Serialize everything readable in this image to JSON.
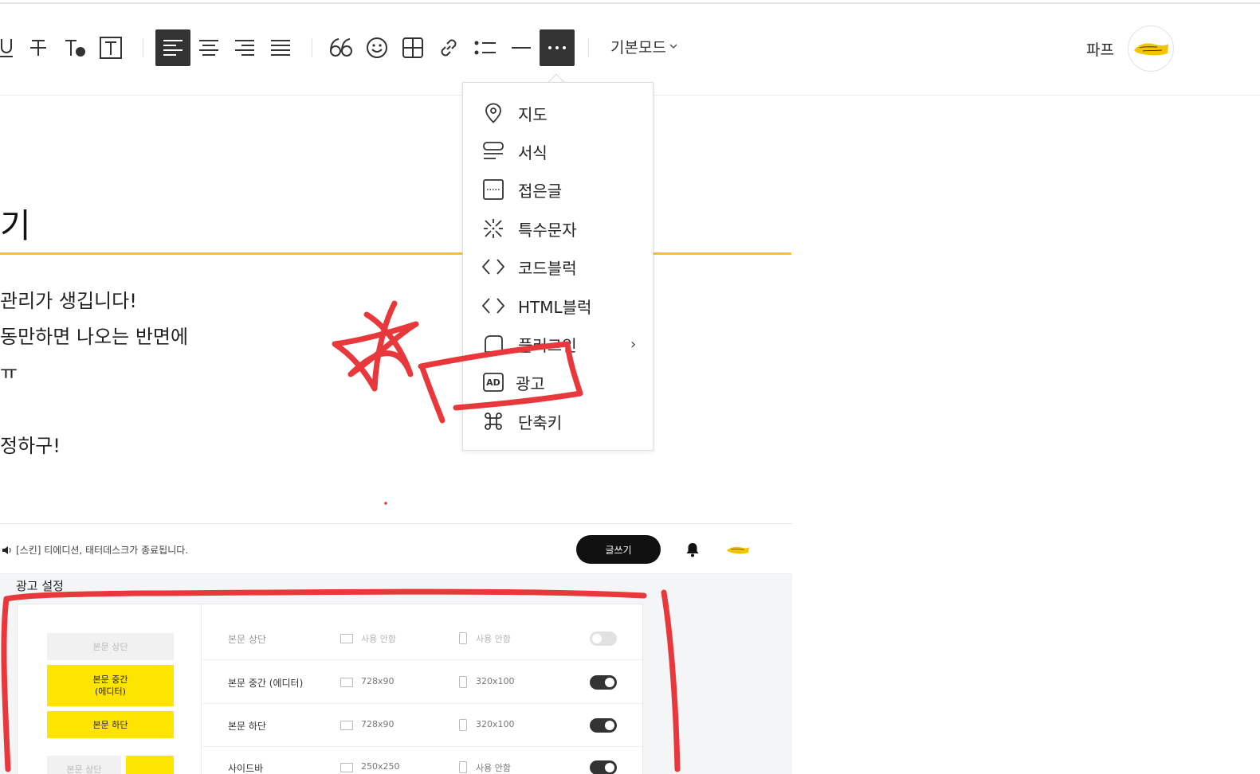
{
  "toolbar": {
    "mode_label": "기본모드",
    "user_name": "파프",
    "buttons": [
      {
        "name": "underline",
        "icon": "underline-icon"
      },
      {
        "name": "strikethrough",
        "icon": "strikethrough-icon"
      },
      {
        "name": "text-color",
        "icon": "text-color-icon"
      },
      {
        "name": "text-background",
        "icon": "text-background-icon"
      },
      {
        "name": "align-left",
        "icon": "align-left-icon",
        "active": true
      },
      {
        "name": "align-center",
        "icon": "align-center-icon"
      },
      {
        "name": "align-right",
        "icon": "align-right-icon"
      },
      {
        "name": "align-justify",
        "icon": "align-justify-icon"
      },
      {
        "name": "quote",
        "icon": "quote-icon"
      },
      {
        "name": "emoticon",
        "icon": "smiley-icon"
      },
      {
        "name": "table",
        "icon": "table-icon"
      },
      {
        "name": "link",
        "icon": "link-icon"
      },
      {
        "name": "list",
        "icon": "list-icon"
      },
      {
        "name": "divider",
        "icon": "horizontal-line-icon"
      },
      {
        "name": "more",
        "icon": "more-icon",
        "active": true
      }
    ]
  },
  "more_menu": {
    "items": [
      {
        "label": "지도",
        "icon": "map-pin-icon"
      },
      {
        "label": "서식",
        "icon": "template-icon"
      },
      {
        "label": "접은글",
        "icon": "fold-box-icon"
      },
      {
        "label": "특수문자",
        "icon": "special-char-icon"
      },
      {
        "label": "코드블럭",
        "icon": "code-icon"
      },
      {
        "label": "HTML블럭",
        "icon": "code-icon"
      },
      {
        "label": "플러그인",
        "icon": "plugin-icon",
        "has_submenu": true
      },
      {
        "label": "광고",
        "icon": "ad-icon",
        "icon_text": "AD"
      },
      {
        "label": "단축키",
        "icon": "command-icon"
      }
    ]
  },
  "post": {
    "title_fragment": "기",
    "lines": [
      "관리가 생깁니다!",
      "동만하면 나오는 반면에",
      "ㅠ",
      "정하구!"
    ]
  },
  "embedded_screenshot": {
    "notice": "[스킨] 티에디션, 태터데스크가 종료됩니다.",
    "write_button": "글쓰기",
    "section_title": "광고 설정",
    "slots": [
      {
        "label": "본문 상단",
        "enabled": false
      },
      {
        "label": "본문 중간\n(에디터)",
        "enabled": true
      },
      {
        "label": "본문 하단",
        "enabled": true
      },
      {
        "label": "본문 상단",
        "enabled": false
      },
      {
        "label": "",
        "enabled": true
      }
    ],
    "rows": [
      {
        "label": "본문 상단",
        "pc": "사용 안함",
        "mobile": "사용 안함",
        "enabled": false
      },
      {
        "label": "본문 중간 (에디터)",
        "pc": "728x90",
        "mobile": "320x100",
        "enabled": true
      },
      {
        "label": "본문 하단",
        "pc": "728x90",
        "mobile": "320x100",
        "enabled": true
      },
      {
        "label": "사이드바",
        "pc": "250x250",
        "mobile": "사용 안함",
        "enabled": true
      }
    ]
  },
  "colors": {
    "accent_yellow": "#ffe400",
    "title_underline": "#f2c814",
    "annotation_red": "#e8383b",
    "active_button": "#333333"
  }
}
